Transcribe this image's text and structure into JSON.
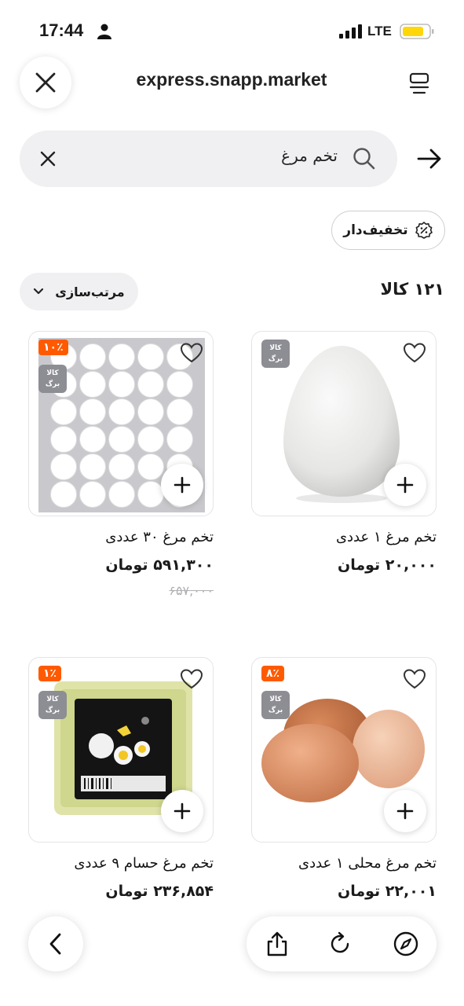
{
  "status_bar": {
    "time": "17:44",
    "network": "LTE"
  },
  "header": {
    "url": "express.snapp.market"
  },
  "search": {
    "query": "تخم مرغ"
  },
  "filters": {
    "discount_chip": "تخفیف‌دار",
    "sort_label": "مرتب‌سازی"
  },
  "results": {
    "count_label": "۱۲۱ کالا"
  },
  "products": [
    {
      "name": "تخم مرغ ۱ عددی",
      "price": "۲۰,۰۰۰ تومان",
      "old_price": "",
      "discount": "",
      "kala_badge": "کالا برگ"
    },
    {
      "name": "تخم مرغ ۳۰ عددی",
      "price": "۵۹۱,۳۰۰ تومان",
      "old_price": "۶۵۷,۰۰۰",
      "discount": "۱۰٪",
      "kala_badge": "کالا برگ"
    },
    {
      "name": "تخم مرغ محلی ۱ عددی",
      "price": "۲۲,۰۰۱ تومان",
      "old_price": "",
      "discount": "۸٪",
      "kala_badge": "کالا برگ"
    },
    {
      "name": "تخم مرغ حسام ۹ عددی",
      "price": "۲۳۶,۸۵۴ تومان",
      "old_price": "",
      "discount": "۱٪",
      "kala_badge": "کالا برگ"
    }
  ],
  "colors": {
    "discount_badge": "#ff5a00",
    "kala_badge": "#8d8d94",
    "battery": "#ffd60a"
  }
}
